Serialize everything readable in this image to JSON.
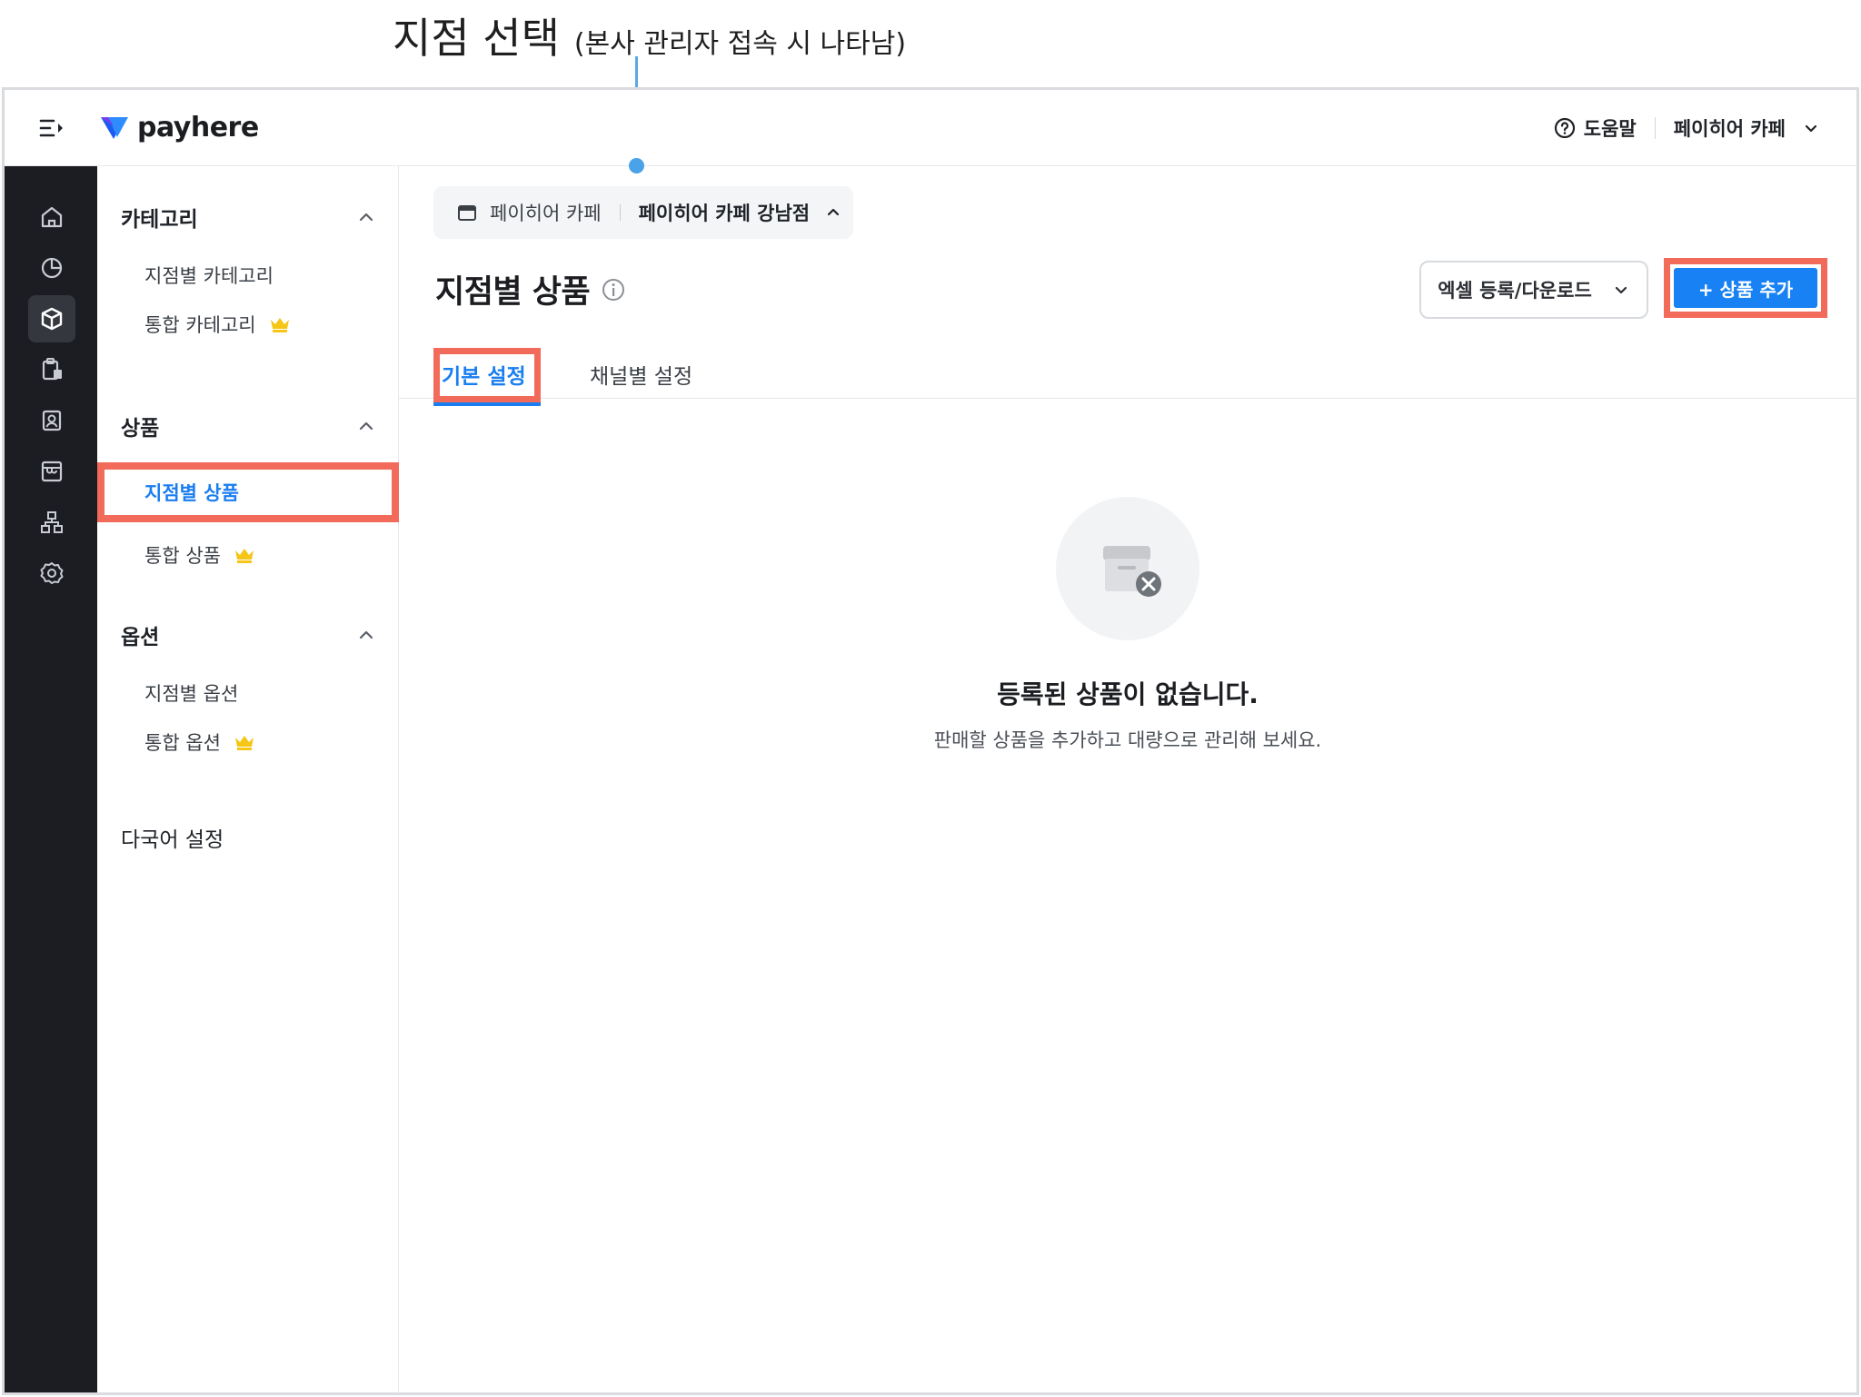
{
  "annotation": {
    "title": "지점 선택",
    "subtitle": "(본사 관리자 접속 시 나타남)"
  },
  "brand": {
    "name": "payhere",
    "accent": "#1882f5",
    "highlight": "#f26a5a"
  },
  "topbar": {
    "help_label": "도움말",
    "account_label": "페이히어 카페"
  },
  "rail": {
    "items": [
      "home-icon",
      "chart-icon",
      "box-icon",
      "clipboard-icon",
      "contact-icon",
      "store-icon",
      "org-icon",
      "gear-icon"
    ],
    "active_index": 2
  },
  "sidebar": {
    "category": {
      "label": "카테고리",
      "items": [
        "지점별 카테고리",
        "통합 카테고리"
      ]
    },
    "product": {
      "label": "상품",
      "items": [
        "지점별 상품",
        "통합 상품"
      ]
    },
    "option": {
      "label": "옵션",
      "items": [
        "지점별 옵션",
        "통합 옵션"
      ]
    },
    "language": "다국어 설정"
  },
  "branch_selector": {
    "hq": "페이히어 카페",
    "current": "페이히어 카페 강남점"
  },
  "page": {
    "title": "지점별 상품",
    "excel_label": "엑셀 등록/다운로드",
    "add_label": "+ 상품 추가"
  },
  "tabs": [
    "기본 설정",
    "채널별 설정"
  ],
  "empty": {
    "title": "등록된 상품이 없습니다.",
    "description": "판매할 상품을 추가하고 대량으로 관리해 보세요."
  }
}
